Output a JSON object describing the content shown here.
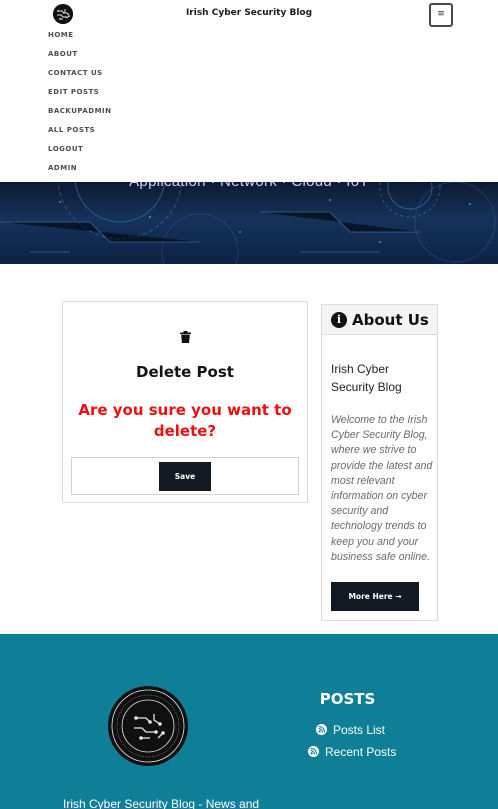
{
  "header": {
    "site_title": "Irish Cyber Security Blog",
    "menu_toggle_icon": "≡"
  },
  "nav": {
    "items": [
      "HOME",
      "ABOUT",
      "CONTACT US",
      "EDIT POSTS",
      "BACKUPADMIN",
      "ALL POSTS",
      "LOGOUT",
      "ADMIN"
    ]
  },
  "hero": {
    "tags": "Application · Network · Cloud · IoT"
  },
  "main": {
    "card_title": "Delete Post",
    "confirm_text": "Are you sure you want to delete?",
    "save_label": "Save",
    "icon": "trash-icon"
  },
  "sidebar": {
    "title": "About Us",
    "name": "Irish Cyber Security Blog",
    "description": "Welcome to the Irish Cyber Security Blog, where we strive to provide the latest and most relevant information on cyber security and technology trends to keep you and your business safe online.",
    "more_label": "More Here →",
    "icon": "info-icon"
  },
  "footer": {
    "posts_title": "POSTS",
    "links": [
      "Posts List",
      "Recent Posts"
    ],
    "tagline": "Irish Cyber Security Blog - News and",
    "background": "#0f7f98"
  },
  "colors": {
    "accent_red": "#ee1010",
    "button_dark": "#121923",
    "footer_teal": "#0f7f98"
  }
}
